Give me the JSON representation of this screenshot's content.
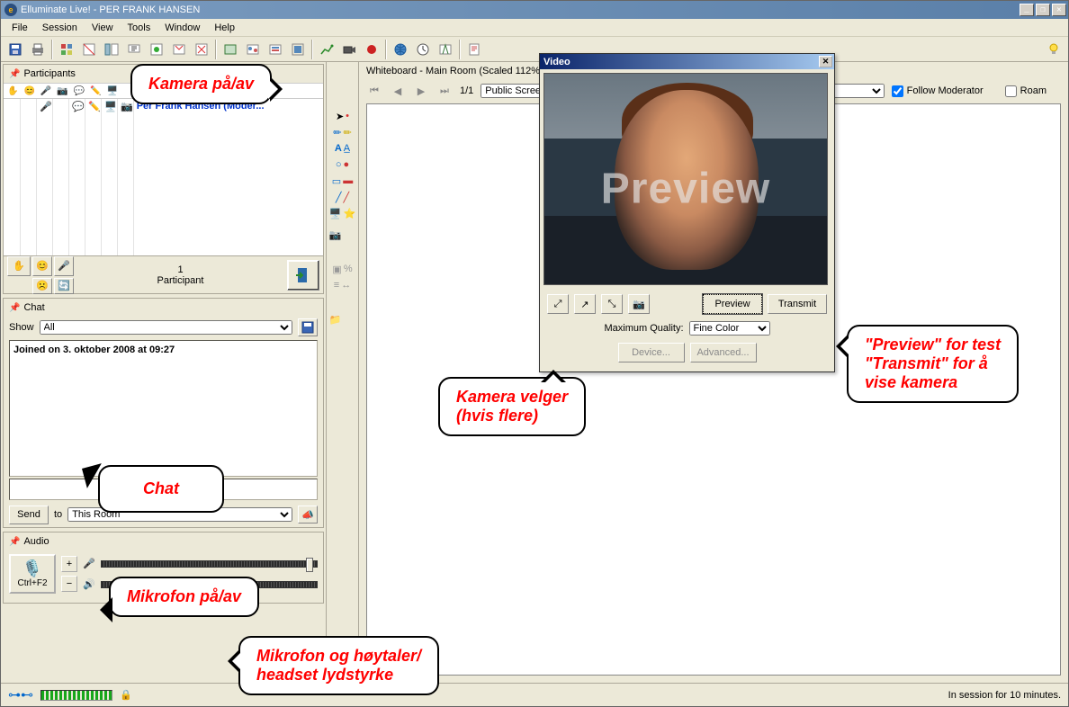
{
  "title": "Elluminate Live! - PER FRANK HANSEN",
  "menus": [
    "File",
    "Session",
    "View",
    "Tools",
    "Window",
    "Help"
  ],
  "participants": {
    "header": "Participants",
    "row": {
      "name": "Per Frank Hansen (Moder..."
    },
    "count_num": "1",
    "count_label": "Participant"
  },
  "chat": {
    "header": "Chat",
    "show_label": "Show",
    "show_value": "All",
    "transcript": "Joined on 3. oktober 2008 at 09:27",
    "send_label": "Send",
    "to_label": "to",
    "to_value": "This Room"
  },
  "audio": {
    "header": "Audio",
    "talk_shortcut": "Ctrl+F2"
  },
  "whiteboard": {
    "title": "Whiteboard - Main Room (Scaled 112%)",
    "page": "1/1",
    "screen_select": "Public Screen 1",
    "follow_label": "Follow Moderator",
    "roam_label": "Roam"
  },
  "video": {
    "title": "Video",
    "overlay": "Preview",
    "preview_btn": "Preview",
    "transmit_btn": "Transmit",
    "quality_label": "Maximum Quality:",
    "quality_value": "Fine Color",
    "device_btn": "Device...",
    "advanced_btn": "Advanced..."
  },
  "callouts": {
    "c1": "Kamera på/av",
    "c2": "Kamera velger\n(hvis flere)",
    "c3": "\"Preview\" for test\n\"Transmit\" for å\nvise kamera",
    "c4": "Chat",
    "c5": "Mikrofon på/av",
    "c6": "Mikrofon og høytaler/\nheadset lydstyrke"
  },
  "status": "In session for 10 minutes."
}
